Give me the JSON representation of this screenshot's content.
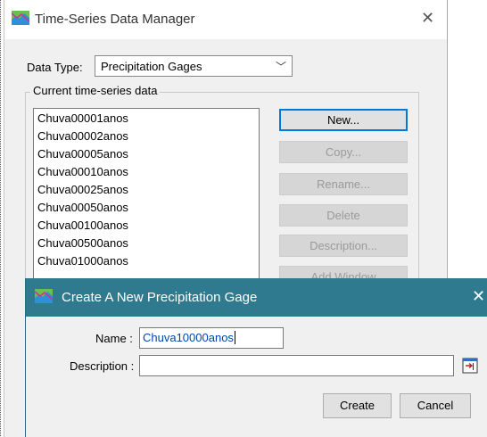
{
  "main_window": {
    "title": "Time-Series Data Manager",
    "icon": "app-icon",
    "data_type_label": "Data Type:",
    "data_type_value": "Precipitation Gages",
    "group_label": "Current time-series data",
    "list_items": [
      "Chuva00001anos",
      "Chuva00002anos",
      "Chuva00005anos",
      "Chuva00010anos",
      "Chuva00025anos",
      "Chuva00050anos",
      "Chuva00100anos",
      "Chuva00500anos",
      "Chuva01000anos"
    ],
    "buttons": {
      "new": "New...",
      "copy": "Copy...",
      "rename": "Rename...",
      "delete": "Delete",
      "description": "Description...",
      "add_window": "Add Window"
    }
  },
  "dialog": {
    "title": "Create A New Precipitation Gage",
    "name_label": "Name :",
    "name_value": "Chuva10000anos",
    "description_label": "Description :",
    "description_value": "",
    "create_label": "Create",
    "cancel_label": "Cancel"
  },
  "colors": {
    "dialog_titlebar": "#2f7a8e",
    "focus_border": "#0078d7",
    "window_bg": "#f0f0f0"
  }
}
